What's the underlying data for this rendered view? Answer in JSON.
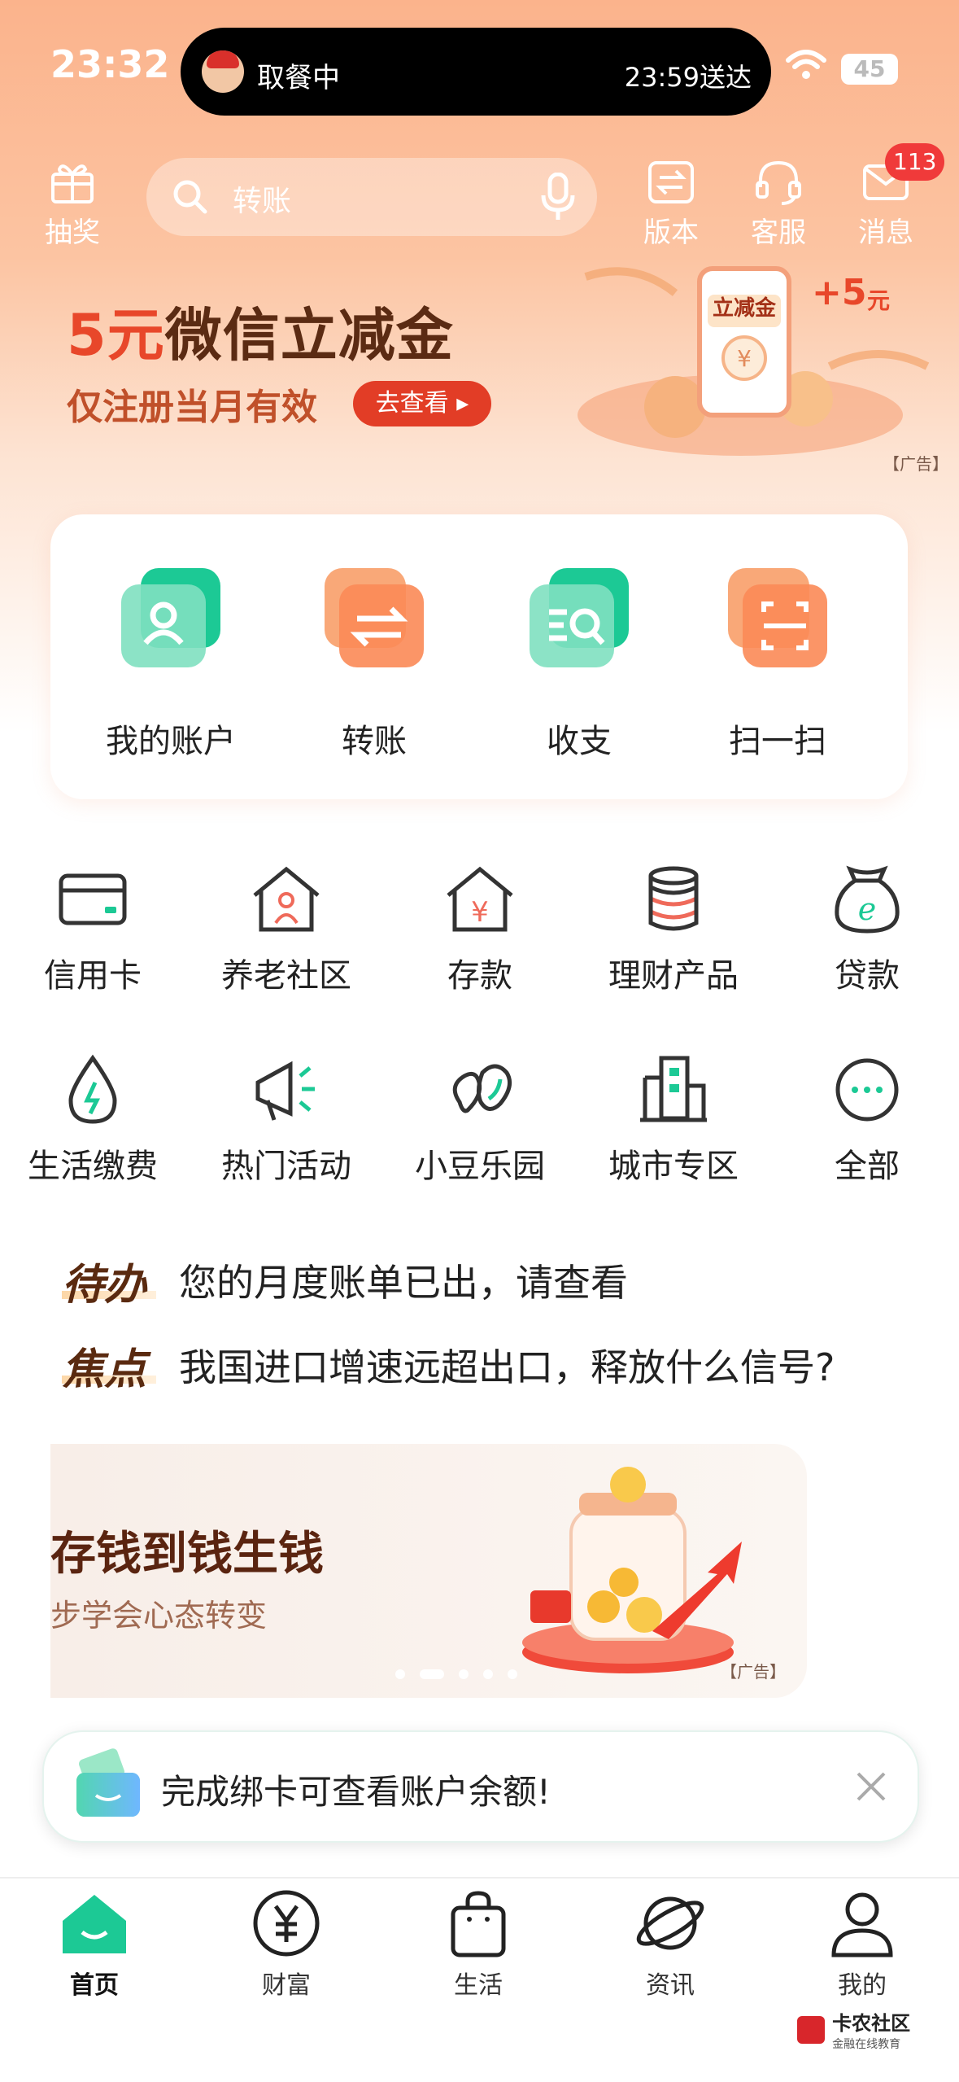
{
  "status_bar": {
    "time": "23:32",
    "live_activity": {
      "left": "取餐中",
      "right": "23:59送达"
    },
    "battery": "45"
  },
  "header": {
    "lottery_label": "抽奖",
    "search_placeholder": "转账",
    "version_label": "版本",
    "service_label": "客服",
    "message_label": "消息",
    "message_badge": "113"
  },
  "banner": {
    "title_highlight": "5元",
    "title_rest": "微信立减金",
    "subtitle": "仅注册当月有效",
    "button": "去查看",
    "coupon_label": "立减金",
    "coupon_value": "+5",
    "coupon_unit": "元",
    "ad_tag": "【广告】"
  },
  "quick_actions": [
    {
      "label": "我的账户",
      "icon": "account-icon"
    },
    {
      "label": "转账",
      "icon": "transfer-icon"
    },
    {
      "label": "收支",
      "icon": "income-expense-icon"
    },
    {
      "label": "扫一扫",
      "icon": "scan-icon"
    }
  ],
  "services": [
    {
      "label": "信用卡",
      "icon": "credit-card-icon"
    },
    {
      "label": "养老社区",
      "icon": "elderly-community-icon"
    },
    {
      "label": "存款",
      "icon": "deposit-icon"
    },
    {
      "label": "理财产品",
      "icon": "wealth-product-icon"
    },
    {
      "label": "贷款",
      "icon": "loan-icon"
    },
    {
      "label": "生活缴费",
      "icon": "utility-payment-icon"
    },
    {
      "label": "热门活动",
      "icon": "hot-activity-icon"
    },
    {
      "label": "小豆乐园",
      "icon": "bean-park-icon"
    },
    {
      "label": "城市专区",
      "icon": "city-zone-icon"
    },
    {
      "label": "全部",
      "icon": "more-icon"
    }
  ],
  "notices": [
    {
      "tag": "待办",
      "text": "您的月度账单已出，请查看"
    },
    {
      "tag": "焦点",
      "text": "我国进口增速远超出口，释放什么信号?"
    }
  ],
  "promo": {
    "title": "存钱到钱生钱",
    "subtitle": "步学会心态转变",
    "ad_tag": "【广告】"
  },
  "toast": {
    "text": "完成绑卡可查看账户余额!"
  },
  "tab_bar": [
    {
      "label": "首页",
      "icon": "home-icon",
      "active": true
    },
    {
      "label": "财富",
      "icon": "wealth-icon",
      "active": false
    },
    {
      "label": "生活",
      "icon": "life-bag-icon",
      "active": false
    },
    {
      "label": "资讯",
      "icon": "news-planet-icon",
      "active": false
    },
    {
      "label": "我的",
      "icon": "profile-icon",
      "active": false
    }
  ],
  "watermark": {
    "name": "卡农社区",
    "sub": "金融在线教育"
  },
  "colors": {
    "accent_green": "#1cc995",
    "accent_orange": "#f9864e",
    "badge_red": "#f03a3a"
  }
}
